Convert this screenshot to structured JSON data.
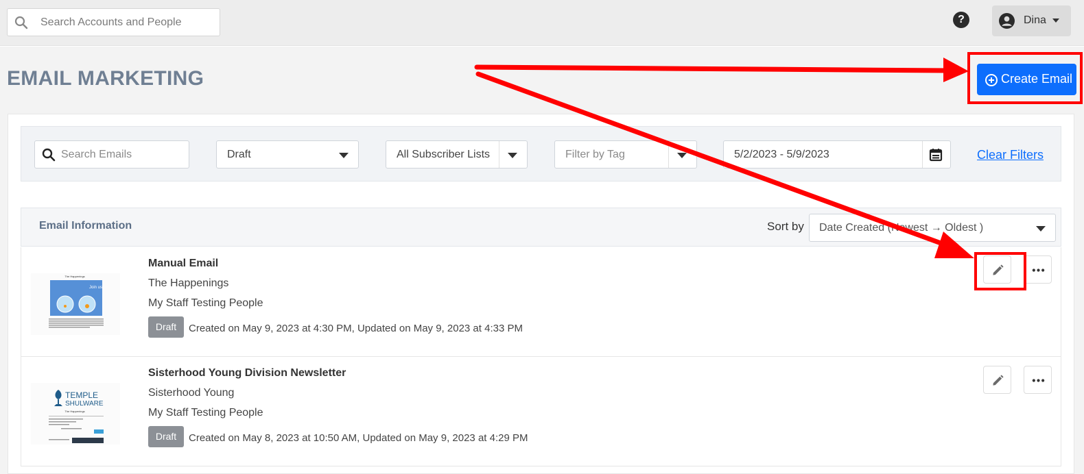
{
  "topbar": {
    "search_placeholder": "Search Accounts and People",
    "help_label": "?",
    "user_name": "Dina"
  },
  "page": {
    "title": "EMAIL MARKETING",
    "create_button": "Create Email"
  },
  "filters": {
    "search_placeholder": "Search Emails",
    "status": "Draft",
    "subscriber_list": "All Subscriber Lists",
    "tag_placeholder": "Filter by Tag",
    "date_range": "5/2/2023 - 5/9/2023",
    "clear_label": "Clear Filters"
  },
  "list": {
    "header_title": "Email Information",
    "sort_label": "Sort by",
    "sort_value": "Date Created (Newest → Oldest )"
  },
  "emails": [
    {
      "name": "Manual Email",
      "group": "The Happenings",
      "audience": "My Staff Testing People",
      "status": "Draft",
      "meta": "Created on May 9, 2023 at 4:30 PM, Updated on May 9, 2023 at 4:33 PM",
      "thumb_title": "The Happenings",
      "thumb_overlay": "Join us"
    },
    {
      "name": "Sisterhood Young Division Newsletter",
      "group": "Sisterhood Young",
      "audience": "My Staff Testing People",
      "status": "Draft",
      "meta": "Created on May 8, 2023 at 10:50 AM, Updated on May 9, 2023 at 4:29 PM",
      "thumb_brand_line1": "TEMPLE",
      "thumb_brand_line2": "SHULWARE",
      "thumb_title": "The Happenings"
    }
  ],
  "annotation": {
    "color": "#ff0000"
  }
}
